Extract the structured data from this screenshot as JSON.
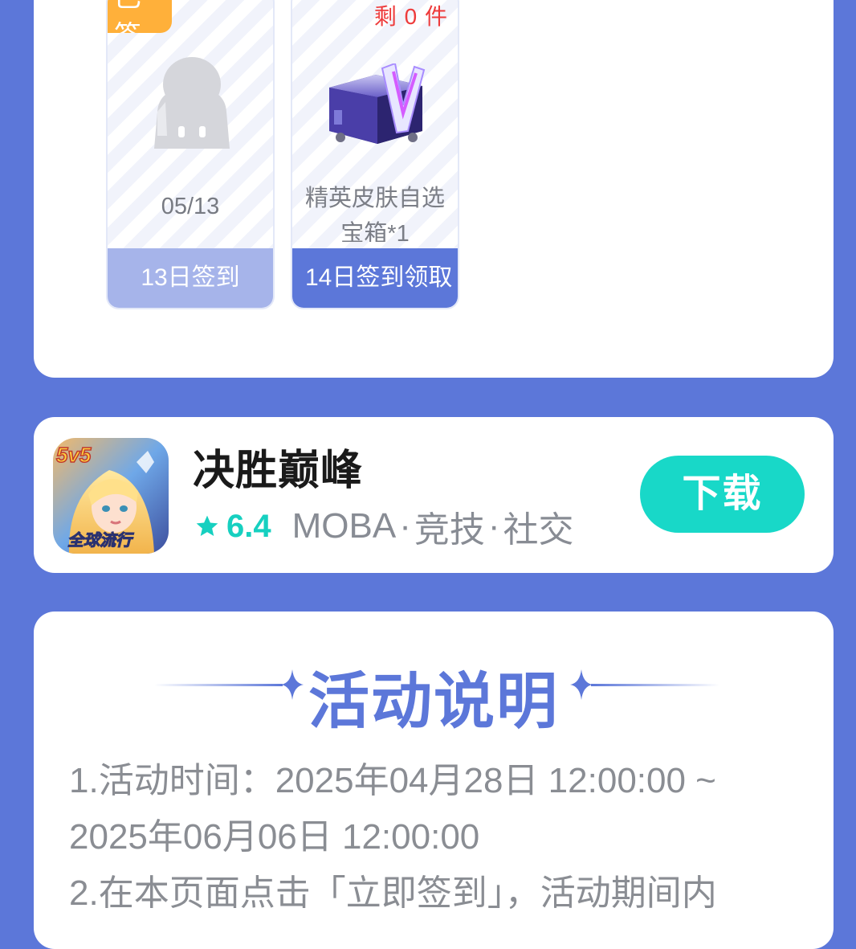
{
  "checkin": {
    "days": [
      {
        "badge": "已签",
        "date": "05/13",
        "footer": "13日签到"
      },
      {
        "remaining": "剩 0 件",
        "prize_name": "精英皮肤自选宝箱*1",
        "footer": "14日签到领取"
      }
    ]
  },
  "game": {
    "title": "决胜巅峰",
    "rating": "6.4",
    "tags": [
      "MOBA",
      "竞技",
      "社交"
    ],
    "icon_badge": "5v5",
    "icon_caption": "全球流行",
    "download_label": "下载"
  },
  "activity": {
    "title": "活动说明",
    "rules": [
      "1.活动时间：2025年04月28日 12:00:00 ~ 2025年06月06日 12:00:00",
      "2.在本页面点击「立即签到」，活动期间内"
    ]
  },
  "colors": {
    "background": "#5c77d9",
    "accent": "#5c77d9",
    "download": "#18d8c8",
    "remaining": "#ee3b3b",
    "badge": "#ffb03a"
  }
}
